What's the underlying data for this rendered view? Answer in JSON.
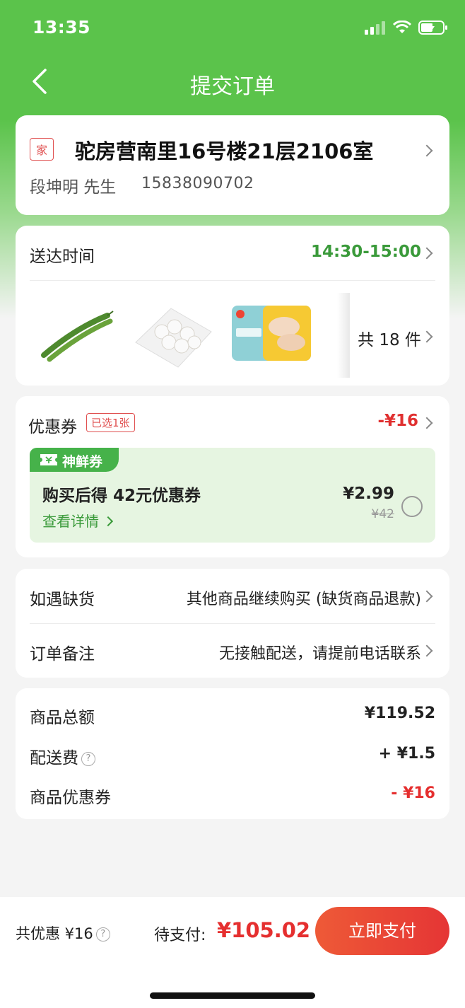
{
  "status_bar": {
    "time": "13:35"
  },
  "nav": {
    "title": "提交订单"
  },
  "address": {
    "tag": "家",
    "address": "驼房营南里16号楼21层2106室",
    "name": "段坤明  先生",
    "phone": "15838090702"
  },
  "delivery": {
    "label": "送达时间",
    "time": "14:30-15:00",
    "items": [
      "green-beans",
      "mushrooms",
      "chicken-pack"
    ],
    "count": "共 18 件"
  },
  "coupon": {
    "label": "优惠券",
    "selected": "已选1张",
    "amount": "-¥16",
    "badge": "神鲜券",
    "title": "购买后得 42元优惠券",
    "detail": "查看详情",
    "price": "¥2.99",
    "original": "¥42"
  },
  "options": {
    "stockout_label": "如遇缺货",
    "stockout_value": "其他商品继续购买 (缺货商品退款)",
    "note_label": "订单备注",
    "note_value": "无接触配送，请提前电话联系"
  },
  "summary": {
    "total_label": "商品总额",
    "total_value": "¥119.52",
    "fee_label": "配送费",
    "fee_value": "+ ¥1.5",
    "coupon_label": "商品优惠券",
    "coupon_value": "- ¥16"
  },
  "bottom": {
    "saved": "共优惠 ¥16",
    "pay_label": "待支付:",
    "pay_amount": "¥105.02",
    "pay_button": "立即支付"
  },
  "colors": {
    "brand_green": "#5bc34b",
    "accent_red": "#e52f2f",
    "time_green": "#3a9a3a"
  }
}
